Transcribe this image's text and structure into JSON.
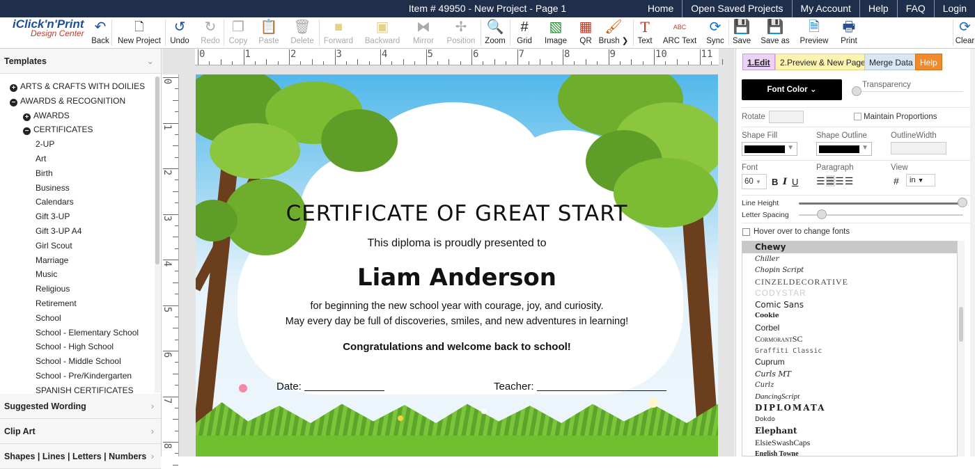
{
  "window": {
    "title": "Item # 49950 - New Project - Page 1"
  },
  "topnav": [
    "Home",
    "Open Saved Projects",
    "My Account",
    "Help",
    "FAQ",
    "Login"
  ],
  "logo": {
    "line1": "iClick'n'Print",
    "line2": "Design Center"
  },
  "toolbar": {
    "back": "Back",
    "new_project": "New Project",
    "undo": "Undo",
    "redo": "Redo",
    "copy": "Copy",
    "paste": "Paste",
    "delete": "Delete",
    "forward": "Forward",
    "backward": "Backward",
    "mirror": "Mirror",
    "position": "Position",
    "zoom": "Zoom",
    "grid": "Grid",
    "image": "Image",
    "qr": "QR",
    "brush": "Brush ❯",
    "text": "Text",
    "arc_text": "ARC Text",
    "sync": "Sync",
    "save": "Save",
    "save_as": "Save as",
    "preview": "Preview",
    "print": "Print",
    "clear": "Clear",
    "text_icon": "T",
    "arc_icon": "ABC"
  },
  "sidebar": {
    "sections": [
      "Templates",
      "Suggested Wording",
      "Clip Art",
      "Shapes | Lines | Letters | Numbers"
    ],
    "tree": [
      {
        "label": "ARTS & CRAFTS WITH DOILIES",
        "level": 0,
        "toggle": "+"
      },
      {
        "label": "AWARDS & RECOGNITION",
        "level": 0,
        "toggle": "−"
      },
      {
        "label": "AWARDS",
        "level": 1,
        "toggle": "+"
      },
      {
        "label": "CERTIFICATES",
        "level": 1,
        "toggle": "−"
      },
      {
        "label": "2-UP",
        "level": 2
      },
      {
        "label": "Art",
        "level": 2
      },
      {
        "label": "Birth",
        "level": 2
      },
      {
        "label": "Business",
        "level": 2
      },
      {
        "label": "Calendars",
        "level": 2
      },
      {
        "label": "Gift 3-UP",
        "level": 2
      },
      {
        "label": "Gift 3-UP A4",
        "level": 2
      },
      {
        "label": "Girl Scout",
        "level": 2
      },
      {
        "label": "Marriage",
        "level": 2
      },
      {
        "label": "Music",
        "level": 2
      },
      {
        "label": "Religious",
        "level": 2
      },
      {
        "label": "Retirement",
        "level": 2
      },
      {
        "label": "School",
        "level": 2
      },
      {
        "label": "School - Elementary School",
        "level": 2
      },
      {
        "label": "School - High School",
        "level": 2
      },
      {
        "label": "School - Middle School",
        "level": 2
      },
      {
        "label": "School - Pre/Kindergarten",
        "level": 2
      },
      {
        "label": "SPANISH CERTIFICATES",
        "level": 2
      }
    ]
  },
  "ruler": {
    "h": [
      "0",
      "1",
      "2",
      "3",
      "4",
      "5",
      "6",
      "7",
      "8",
      "9",
      "10",
      "11"
    ],
    "v": [
      "0",
      "1",
      "2",
      "3",
      "4",
      "5",
      "6",
      "7",
      "8"
    ]
  },
  "certificate": {
    "title": "CERTIFICATE OF GREAT START",
    "subtitle": "This diploma is proudly presented to",
    "name": "Liam Anderson",
    "line1": "for beginning the new school year with courage, joy, and curiosity.",
    "line2": "May every day be full of discoveries, smiles, and new adventures in learning!",
    "congrats": "Congratulations and welcome back to school!",
    "date_label": "Date:",
    "teacher_label": "Teacher:"
  },
  "panel": {
    "tabs": [
      "1.Edit",
      "2.Preview & New Page",
      "Merge Data",
      "Help"
    ],
    "font_color": "Font Color",
    "transparency": "Transparency",
    "rotate": "Rotate",
    "maintain": "Maintain Proportions",
    "shape_fill": "Shape Fill",
    "shape_outline": "Shape Outline",
    "outline_width": "OutlineWidth",
    "font": "Font",
    "font_size": "60",
    "paragraph": "Paragraph",
    "view": "View",
    "view_unit": "in",
    "bold": "B",
    "italic": "I",
    "underline": "U",
    "line_height": "Line Height",
    "letter_spacing": "Letter Spacing",
    "hover": "Hover over to change fonts",
    "fonts": [
      "Chewy",
      "Chiller",
      "Chopin Script",
      "CINZELDECORATIVE",
      "CODYSTAR",
      "Comic Sans",
      "Cookie",
      "Corbel",
      "CormorantSC",
      "Graffiti Classic",
      "Cuprum",
      "Curls MT",
      "Curlz",
      "DancingScript",
      "DIPLOMATA",
      "Dokdo",
      "Elephant",
      "ElsieSwashCaps",
      "English Towne"
    ]
  },
  "colors": {
    "topbar": "#1f2e4a",
    "accent_edit": "#ecd2f5",
    "accent_preview": "#fdf3b1",
    "accent_merge": "#d9e6f3",
    "accent_help": "#f08a2c"
  }
}
